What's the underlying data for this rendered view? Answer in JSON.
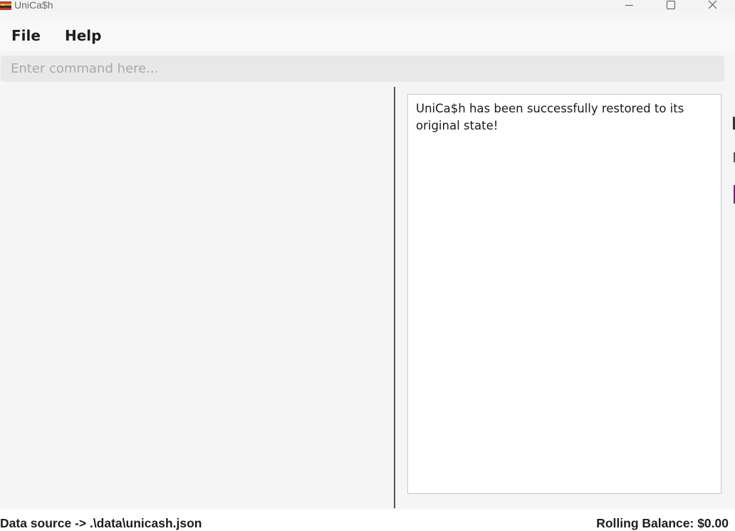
{
  "window": {
    "title": "UniCa$h",
    "icon": "unicash-app-icon",
    "controls": [
      "minimize-icon",
      "maximize-icon",
      "close-icon"
    ]
  },
  "menu": {
    "file_label": "File",
    "help_label": "Help"
  },
  "command": {
    "value": "",
    "placeholder": "Enter command here..."
  },
  "result": {
    "message": "UniCa$h has been successfully restored to its original state!"
  },
  "status": {
    "data_source": "Data source -> .\\data\\unicash.json",
    "rolling_balance": "Rolling Balance: $0.00"
  },
  "colors": {
    "background": "#f5f5f5",
    "command_box": "#e8e8e8",
    "divider": "#555555",
    "result_bg": "#ffffff"
  }
}
